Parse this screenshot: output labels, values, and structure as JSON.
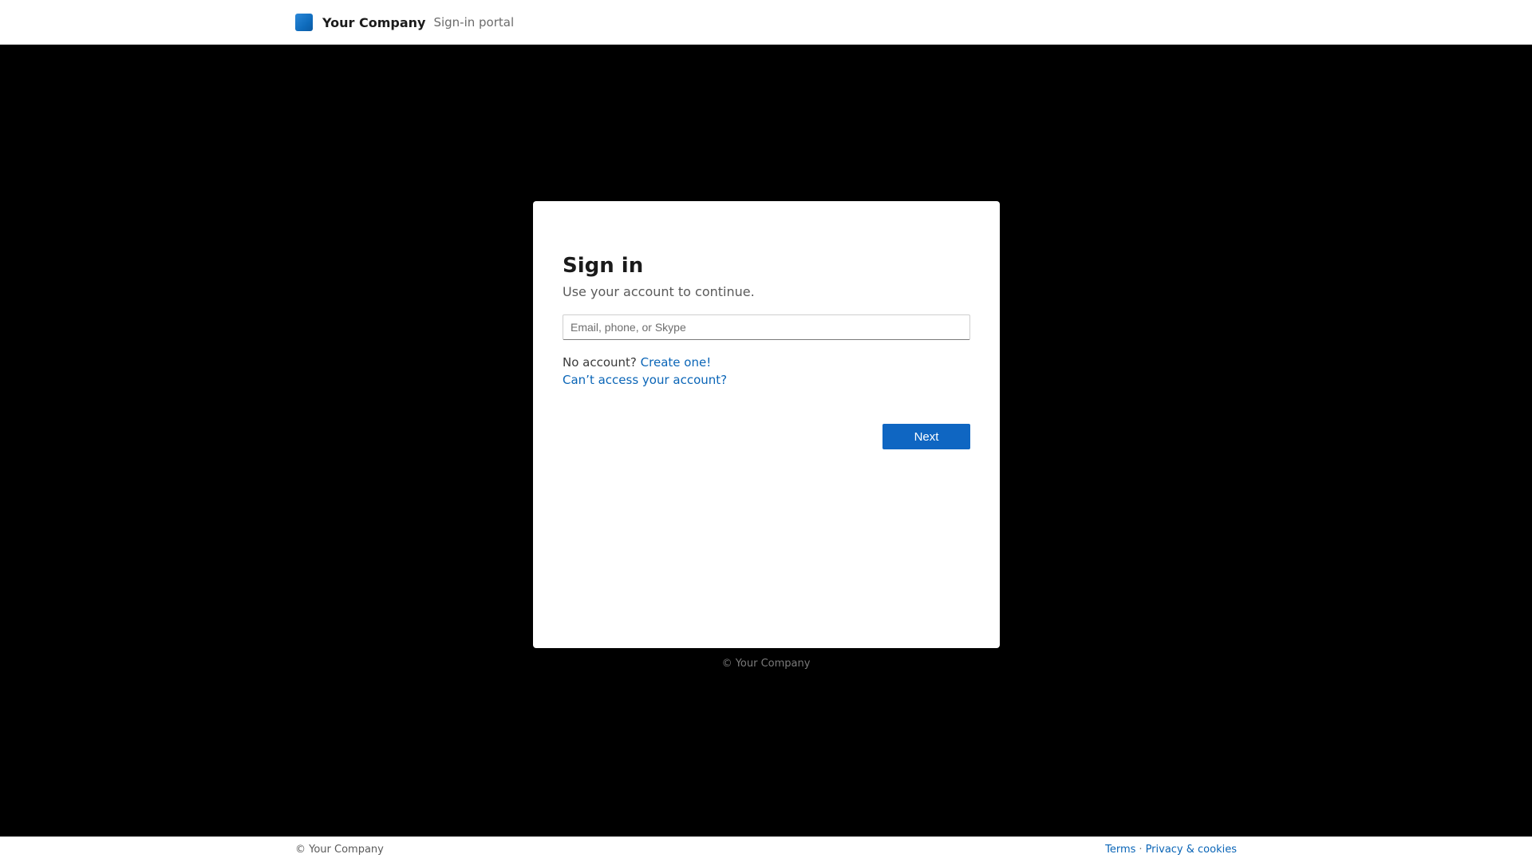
{
  "header": {
    "brand_name": "Your Company",
    "brand_subtitle": "Sign-in portal",
    "logo_icon": "company-logo-square-icon"
  },
  "signin": {
    "title": "Sign in",
    "subtitle": "Use your account to continue.",
    "email_value": "",
    "email_placeholder": "Email, phone, or Skype",
    "no_account_text": "No account?",
    "create_link": "Create one!",
    "cant_access_link": "Can’t access your account?",
    "next_label": "Next"
  },
  "card_footer": {
    "copyright": "© Your Company"
  },
  "footer": {
    "copyright": "© Your Company",
    "terms": "Terms",
    "separator": "·",
    "privacy": "Privacy & cookies"
  },
  "colors": {
    "page_background": "#000000",
    "accent": "#0f66c2",
    "link": "#0a65b7"
  }
}
